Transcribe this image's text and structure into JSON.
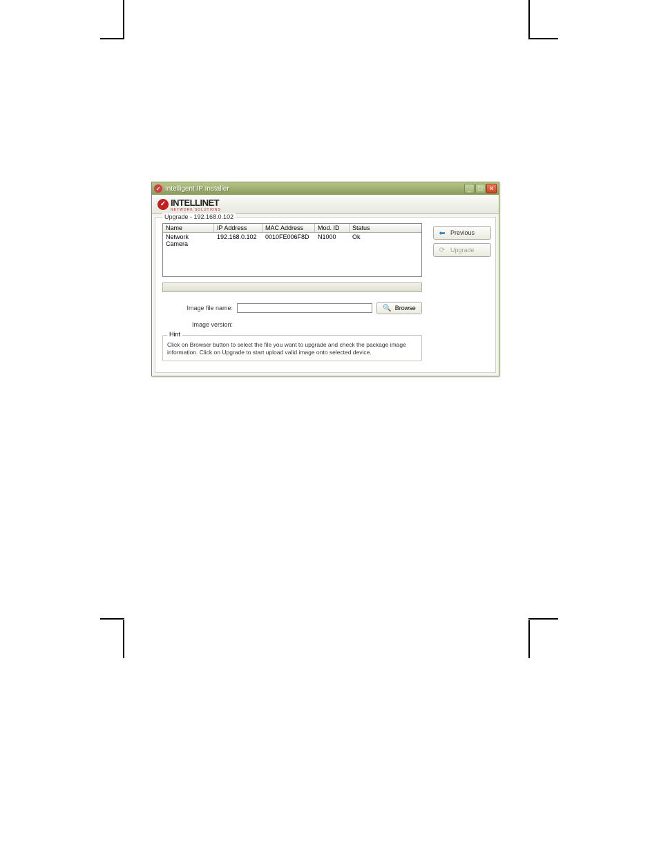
{
  "window": {
    "title": "Intelligent IP Installer"
  },
  "logo": {
    "brand": "INTELLINET",
    "subtitle": "NETWORK SOLUTIONS"
  },
  "group": {
    "title": "Upgrade - 192.168.0.102"
  },
  "table": {
    "headers": {
      "name": "Name",
      "ip": "IP Address",
      "mac": "MAC Address",
      "mod": "Mod. ID",
      "status": "Status"
    },
    "row": {
      "name": "Network Camera",
      "ip": "192.168.0.102",
      "mac": "0010FE006F8D",
      "mod": "N1000",
      "status": "Ok"
    }
  },
  "form": {
    "image_file_label": "Image file name:",
    "image_file_value": "",
    "image_version_label": "Image version:",
    "image_version_value": "",
    "browse_label": "Browse"
  },
  "hint": {
    "title": "Hint",
    "text": "Click on Browser button to select the file you want to upgrade and check the package image information. Click on Upgrade to start upload valid image onto selected device."
  },
  "buttons": {
    "previous": "Previous",
    "upgrade": "Upgrade"
  }
}
